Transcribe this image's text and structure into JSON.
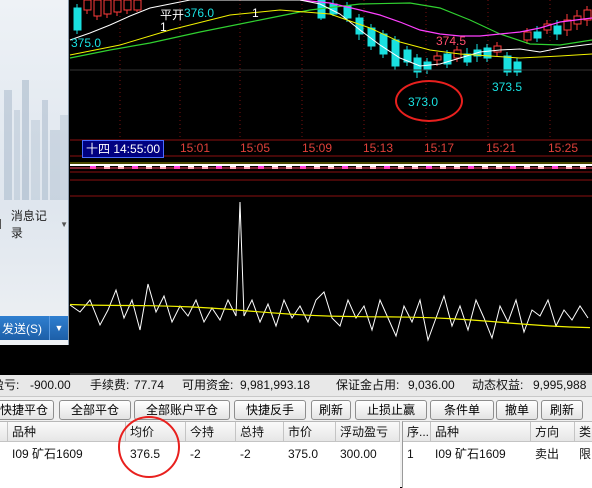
{
  "chart": {
    "price_labels": {
      "flat_open": "平开",
      "p376": "376.0",
      "one_a": "1",
      "one_b": "1",
      "p375": "375.0",
      "p3745": "374.5",
      "p373": "373.0",
      "p3735": "373.5"
    },
    "time_badge": "十四 14:55:00",
    "time_ticks": [
      "15:01",
      "15:05",
      "15:09",
      "15:13",
      "15:17",
      "15:21",
      "15:25"
    ],
    "colors": {
      "up": "#ff3b3b",
      "down": "#19e0e0",
      "ma_white": "#ffffff",
      "ma_yellow": "#f2f200",
      "ma_magenta": "#ff40ff",
      "ma_green": "#30d030"
    }
  },
  "left_panel": {
    "msg_log_label": "消息记录",
    "send_button_label": "发送(S)"
  },
  "summary": {
    "pnl_label": "盈亏:",
    "pnl_value": "-900.00",
    "fee_label": "手续费:",
    "fee_value": "77.74",
    "avail_label": "可用资金:",
    "avail_value": "9,981,993.18",
    "margin_label": "保证金占用:",
    "margin_value": "9,036.00",
    "equity_label": "动态权益:",
    "equity_value": "9,995,988"
  },
  "toolbar": {
    "quick_close": "快捷平仓",
    "close_all": "全部平仓",
    "close_all_accounts": "全部账户平仓",
    "quick_reverse": "快捷反手",
    "refresh": "刷新",
    "stop_loss": "止损止赢",
    "condition_order": "条件单",
    "cancel_order": "撤单",
    "refresh2": "刷新"
  },
  "positions": {
    "headers": [
      "品种",
      "均价",
      "今持",
      "总持",
      "市价",
      "浮动盈亏"
    ],
    "rows": [
      {
        "symbol": "I09 矿石1609",
        "avg_price": "376.5",
        "today": "-2",
        "total": "-2",
        "market": "375.0",
        "float_pnl": "300.00"
      }
    ]
  },
  "orders": {
    "headers": [
      "序...",
      "品种",
      "方向",
      "类"
    ],
    "rows": [
      {
        "seq": "1",
        "symbol": "I09 矿石1609",
        "direction": "卖出",
        "type": "限"
      }
    ]
  }
}
